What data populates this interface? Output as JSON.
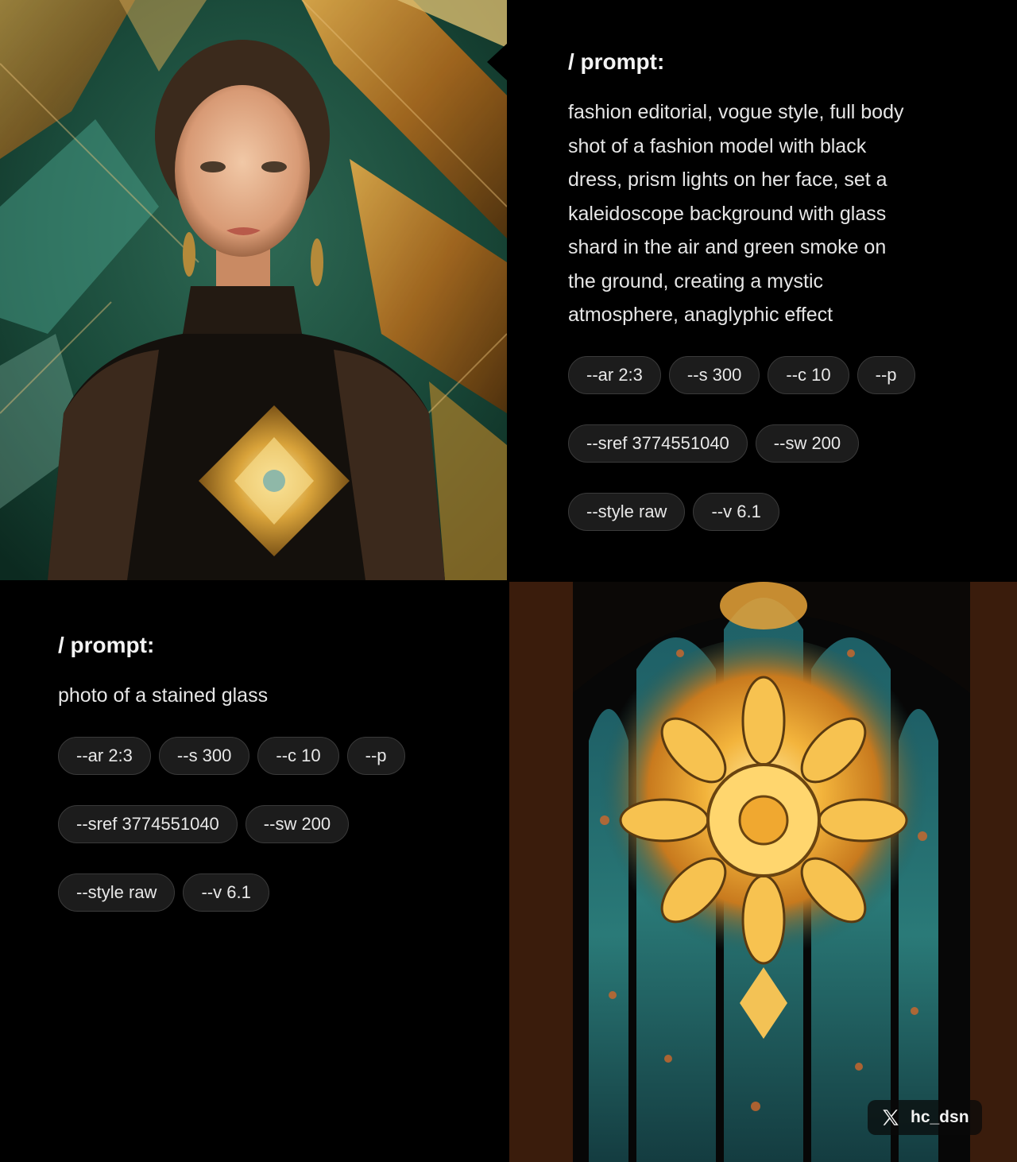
{
  "top_card": {
    "heading": "/ prompt:",
    "prompt_lines": [
      "fashion editorial, vogue style, full body",
      "shot of a fashion model with black",
      "dress, prism lights on her face, set a",
      "kaleidoscope background with glass",
      "shard in the air and green smoke on",
      "the ground, creating a mystic",
      "atmosphere, anaglyphic effect"
    ],
    "params": [
      "--ar 2:3",
      "--s 300",
      "--c 10",
      "--p",
      "--sref 3774551040",
      "--sw 200",
      "--style raw",
      "--v 6.1"
    ]
  },
  "bottom_card": {
    "heading": "/ prompt:",
    "prompt_lines": [
      "photo of a stained glass"
    ],
    "params": [
      "--ar 2:3",
      "--s 300",
      "--c 10",
      "--p",
      "--sref 3774551040",
      "--sw 200",
      "--style raw",
      "--v 6.1"
    ]
  },
  "watermark": {
    "icon": "x-logo-icon",
    "handle": "hc_dsn"
  },
  "colors": {
    "background": "#000000",
    "chip_bg": "#1c1c1c",
    "chip_border": "#3a3a3a",
    "text": "#ececec"
  }
}
